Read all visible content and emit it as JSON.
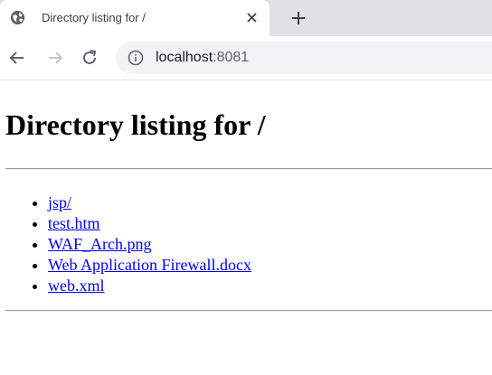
{
  "browser": {
    "tab": {
      "title": "Directory listing for /",
      "close_icon": "close-icon",
      "favicon": "globe-icon"
    },
    "newtab_icon": "plus-icon",
    "nav": {
      "back_icon": "arrow-left-icon",
      "forward_icon": "arrow-right-icon",
      "reload_icon": "reload-icon"
    },
    "address": {
      "host": "localhost",
      "port": ":8081",
      "info_icon": "info-icon"
    }
  },
  "page": {
    "heading": "Directory listing for /",
    "entries": [
      {
        "label": "jsp/"
      },
      {
        "label": "test.htm"
      },
      {
        "label": "WAF_Arch.png"
      },
      {
        "label": "Web Application Firewall.docx"
      },
      {
        "label": "web.xml"
      }
    ],
    "link_color": "#0000ee"
  }
}
